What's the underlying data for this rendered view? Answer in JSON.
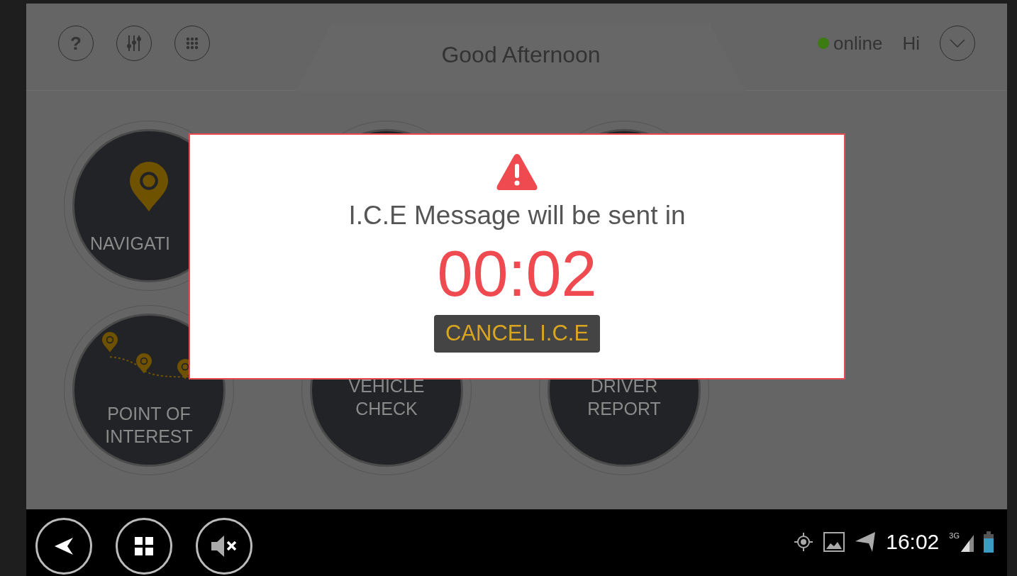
{
  "header": {
    "buttons": [
      {
        "kind": "help",
        "label": "?"
      },
      {
        "kind": "settings"
      },
      {
        "kind": "apps"
      }
    ],
    "title": "Good Afternoon",
    "status": {
      "label": "online",
      "color": "#3c7a12"
    },
    "greeting": "Hi"
  },
  "tiles": [
    {
      "kind": "navigation",
      "label": "NAVIGATI"
    },
    {
      "kind": "blank"
    },
    {
      "kind": "blank"
    },
    {
      "kind": "poi",
      "label": "POINT OF INTEREST"
    },
    {
      "kind": "plain",
      "label": "VEHICLE CHECK"
    },
    {
      "kind": "plain",
      "label": "DRIVER REPORT"
    }
  ],
  "dialog": {
    "message": "I.C.E Message will be sent in",
    "countdown": "00:02",
    "button": "CANCEL I.C.E"
  },
  "nav_bar": {
    "buttons": [
      {
        "kind": "back"
      },
      {
        "kind": "home"
      },
      {
        "kind": "mute"
      }
    ],
    "time": "16:02",
    "network": "3G"
  }
}
